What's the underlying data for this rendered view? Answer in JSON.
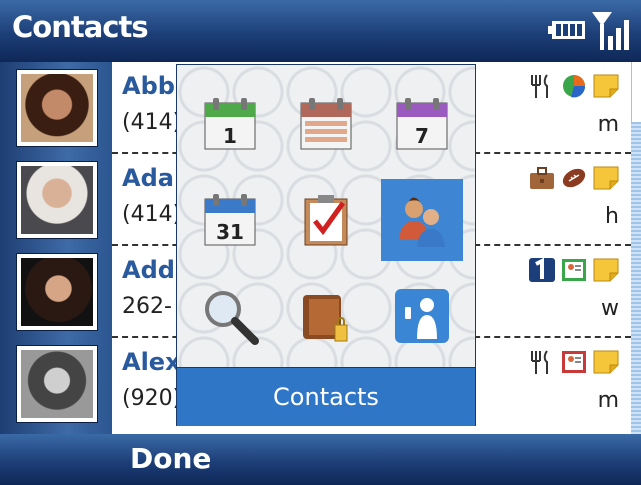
{
  "app": {
    "title": "Contacts"
  },
  "contacts": [
    {
      "name": "Abb",
      "phone": "(414)",
      "letter": "m",
      "icons": [
        "dining-icon",
        "pie-chart-icon",
        "note-icon"
      ]
    },
    {
      "name": "Adar",
      "phone": "(414)",
      "letter": "h",
      "icons": [
        "briefcase-icon",
        "football-icon",
        "note-icon"
      ]
    },
    {
      "name": "Add",
      "phone": "262-",
      "letter": "w",
      "icons": [
        "number-one-icon",
        "contact-card-icon",
        "note-icon"
      ]
    },
    {
      "name": "Alex",
      "phone": "(920)",
      "letter": "m",
      "icons": [
        "dining-icon",
        "contact-card-icon",
        "note-icon"
      ]
    }
  ],
  "popup": {
    "selected_label": "Contacts",
    "grid": [
      [
        "day-calendar-icon",
        "agenda-calendar-icon",
        "week-calendar-icon"
      ],
      [
        "month-calendar-icon",
        "tasks-icon",
        "contacts-icon"
      ],
      [
        "search-icon",
        "wallet-icon",
        "dialer-icon"
      ]
    ],
    "calendar_numbers": {
      "day": "1",
      "week": "7",
      "month": "31"
    }
  },
  "softkeys": {
    "left": "Done"
  },
  "colors": {
    "accent": "#2f77c6",
    "bar": "#1d3f78",
    "name": "#2a5a9e"
  }
}
